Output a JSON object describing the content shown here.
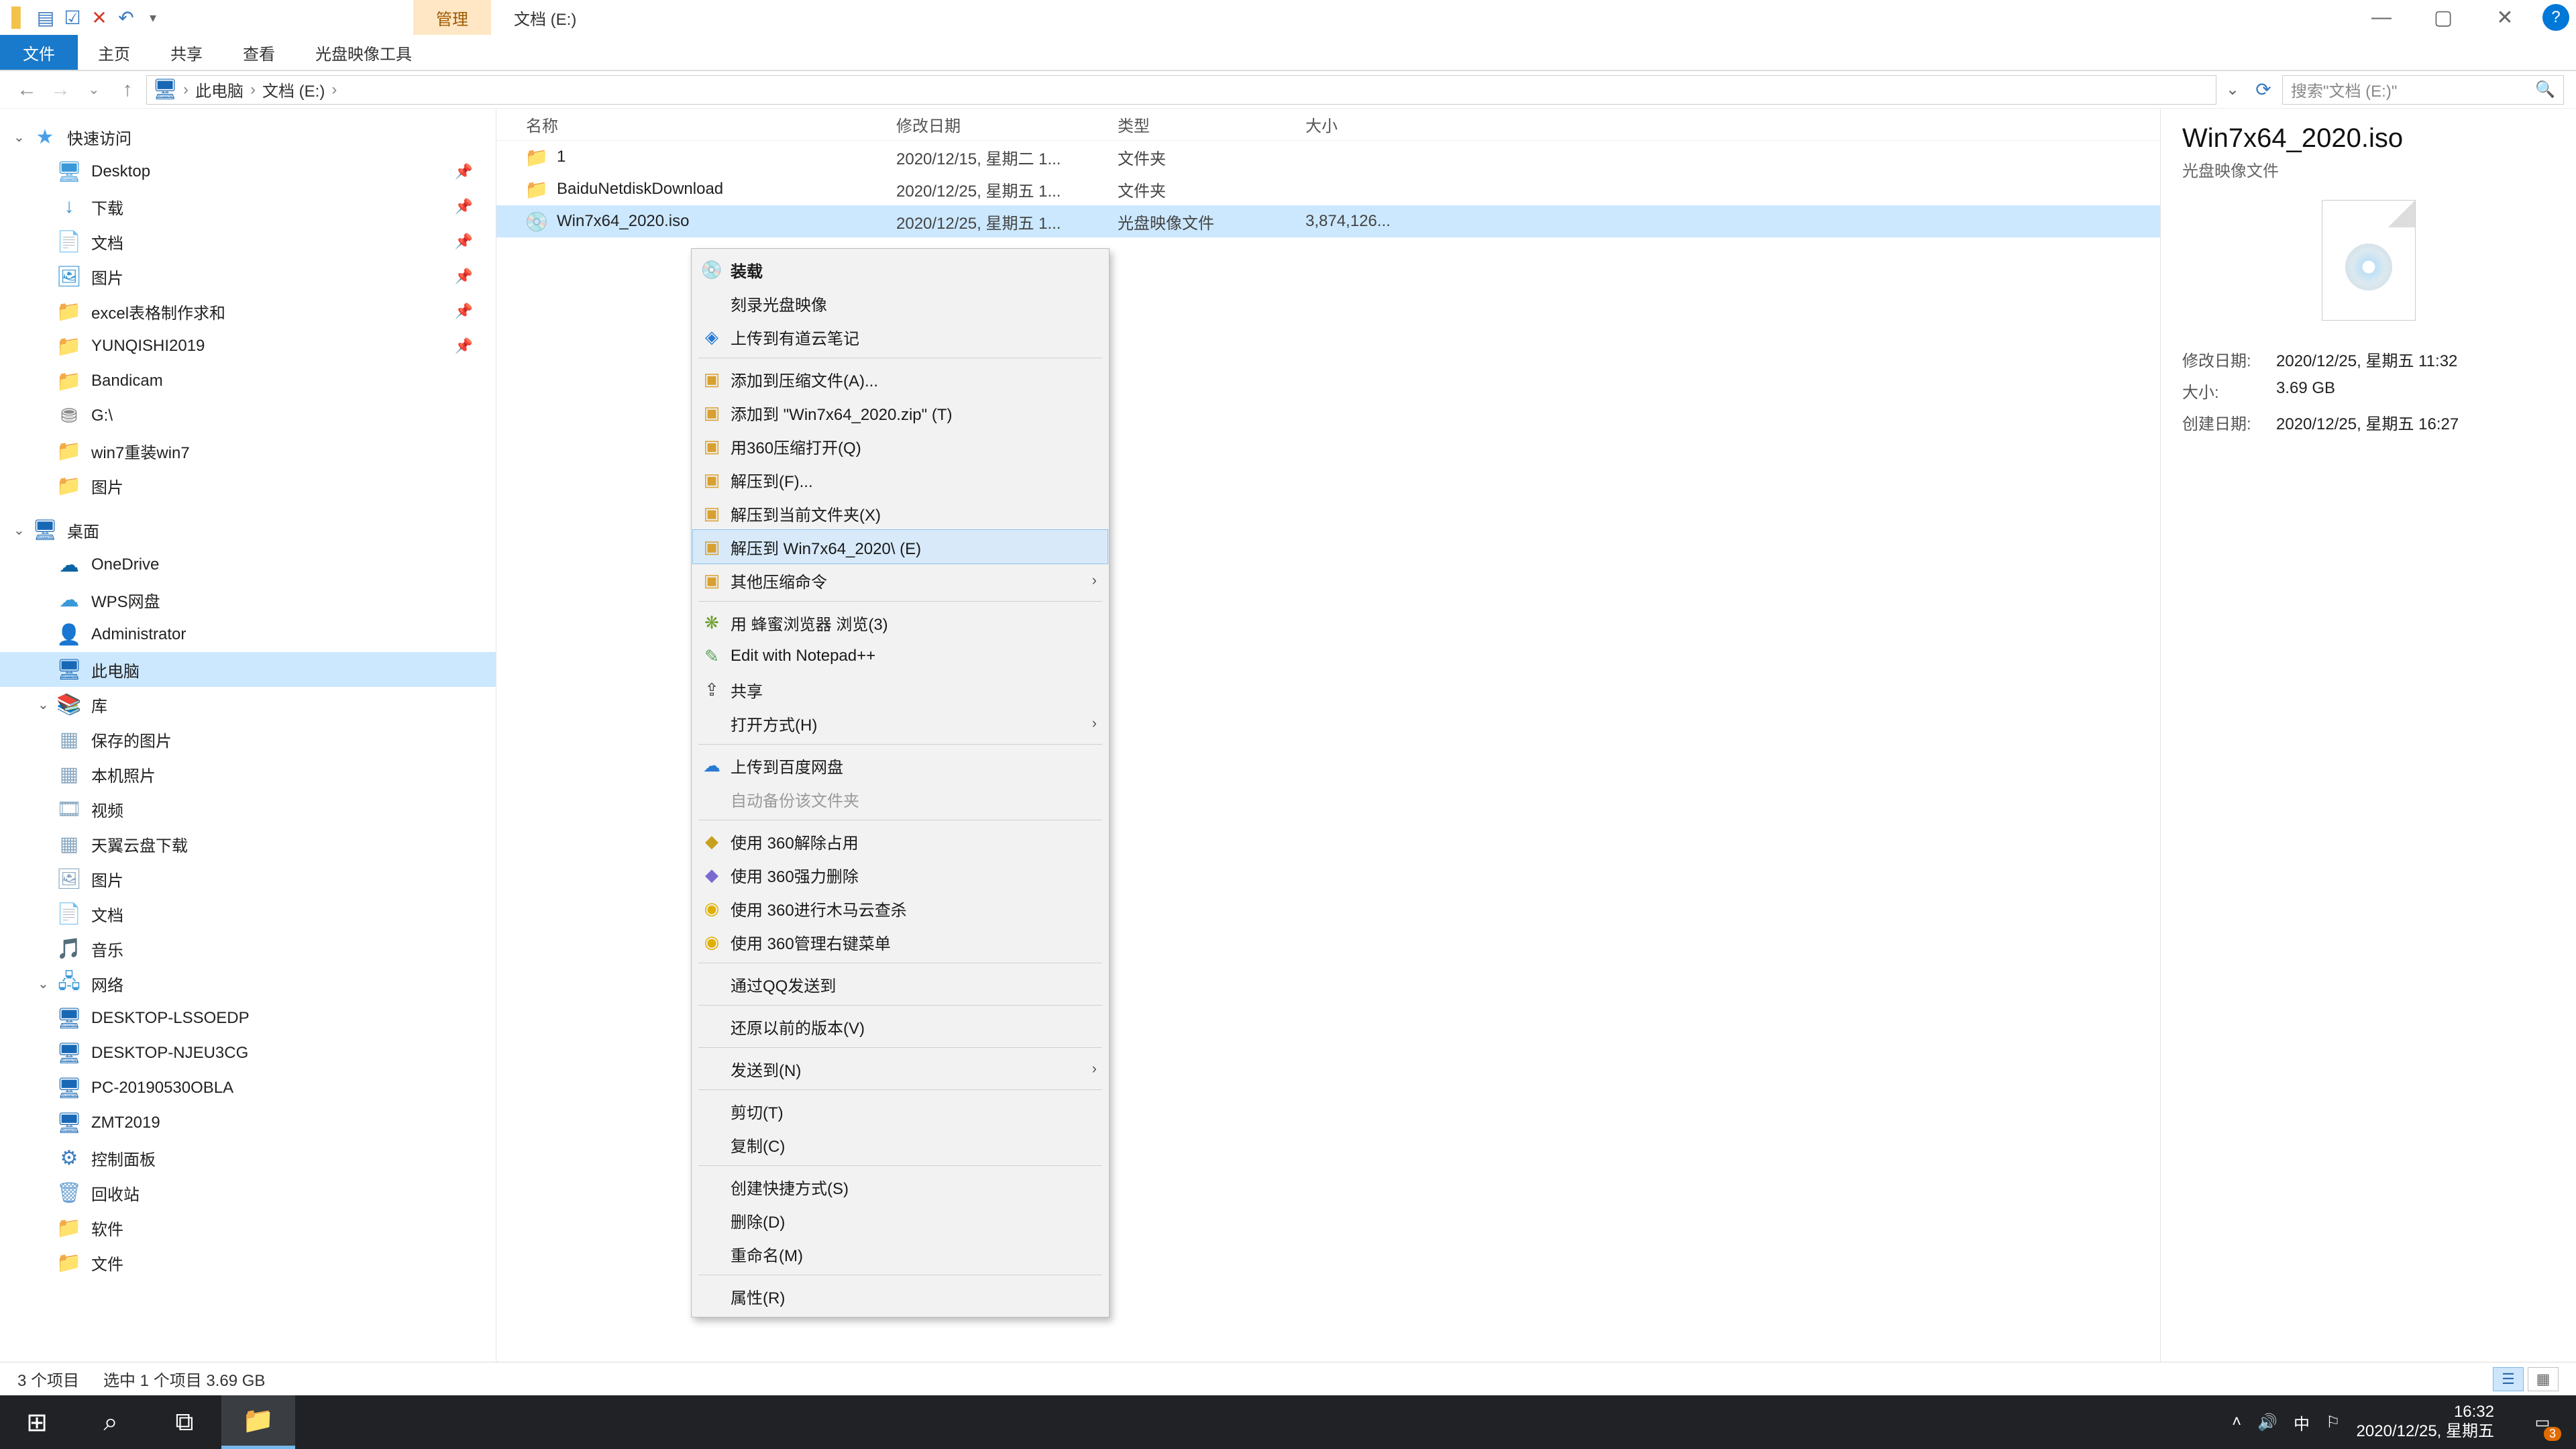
{
  "qat": {
    "dropdown_title": ""
  },
  "title": {
    "ctx_group": "管理",
    "window": "文档 (E:)"
  },
  "win": {
    "min": "—",
    "max": "▢",
    "close": "✕"
  },
  "ribbon": {
    "file": "文件",
    "home": "主页",
    "share": "共享",
    "view": "查看",
    "ctx": "光盘映像工具"
  },
  "addr": {
    "pc": "此电脑",
    "loc": "文档 (E:)",
    "search_placeholder": "搜索\"文档 (E:)\""
  },
  "tree": {
    "quick": "快速访问",
    "desktop": "Desktop",
    "downloads": "下载",
    "documents": "文档",
    "pictures": "图片",
    "excel": "excel表格制作求和",
    "yunqishi": "YUNQISHI2019",
    "bandicam": "Bandicam",
    "gdrive": "G:\\",
    "win7re": "win7重装win7",
    "pics2": "图片",
    "desk_root": "桌面",
    "onedrive": "OneDrive",
    "wps": "WPS网盘",
    "admin": "Administrator",
    "thispc": "此电脑",
    "libs": "库",
    "saved": "保存的图片",
    "camera": "本机照片",
    "videos": "视频",
    "tianyi": "天翼云盘下载",
    "pics3": "图片",
    "docs2": "文档",
    "music": "音乐",
    "network": "网络",
    "d1": "DESKTOP-LSSOEDP",
    "d2": "DESKTOP-NJEU3CG",
    "d3": "PC-20190530OBLA",
    "d4": "ZMT2019",
    "cpl": "控制面板",
    "recycle": "回收站",
    "soft": "软件",
    "files": "文件"
  },
  "cols": {
    "name": "名称",
    "date": "修改日期",
    "type": "类型",
    "size": "大小"
  },
  "rows": [
    {
      "name": "1",
      "date": "2020/12/15, 星期二 1...",
      "type": "文件夹",
      "size": "",
      "icon": "folder"
    },
    {
      "name": "BaiduNetdiskDownload",
      "date": "2020/12/25, 星期五 1...",
      "type": "文件夹",
      "size": "",
      "icon": "folder"
    },
    {
      "name": "Win7x64_2020.iso",
      "date": "2020/12/25, 星期五 1...",
      "type": "光盘映像文件",
      "size": "3,874,126...",
      "icon": "iso"
    }
  ],
  "ctx": {
    "mount": "装载",
    "burn": "刻录光盘映像",
    "youdao": "上传到有道云笔记",
    "addarch": "添加到压缩文件(A)...",
    "addzip": "添加到 \"Win7x64_2020.zip\" (T)",
    "open360": "用360压缩打开(Q)",
    "extractto": "解压到(F)...",
    "extracthere": "解压到当前文件夹(X)",
    "extractdir": "解压到 Win7x64_2020\\ (E)",
    "otherarch": "其他压缩命令",
    "bee": "用 蜂蜜浏览器 浏览(3)",
    "npp": "Edit with Notepad++",
    "share": "共享",
    "openwith": "打开方式(H)",
    "baidu": "上传到百度网盘",
    "autobak": "自动备份该文件夹",
    "unlock360": "使用 360解除占用",
    "forcedel": "使用 360强力删除",
    "trojan": "使用 360进行木马云查杀",
    "menu360": "使用 360管理右键菜单",
    "qqsend": "通过QQ发送到",
    "restore": "还原以前的版本(V)",
    "sendto": "发送到(N)",
    "cut": "剪切(T)",
    "copy": "复制(C)",
    "shortcut": "创建快捷方式(S)",
    "delete": "删除(D)",
    "rename": "重命名(M)",
    "props": "属性(R)"
  },
  "preview": {
    "title": "Win7x64_2020.iso",
    "sub": "光盘映像文件",
    "mdate_l": "修改日期:",
    "mdate_v": "2020/12/25, 星期五 11:32",
    "size_l": "大小:",
    "size_v": "3.69 GB",
    "cdate_l": "创建日期:",
    "cdate_v": "2020/12/25, 星期五 16:27"
  },
  "status": {
    "count": "3 个项目",
    "sel": "选中 1 个项目  3.69 GB"
  },
  "taskbar": {
    "time": "16:32",
    "date": "2020/12/25, 星期五",
    "ime": "中",
    "badge": "3"
  }
}
